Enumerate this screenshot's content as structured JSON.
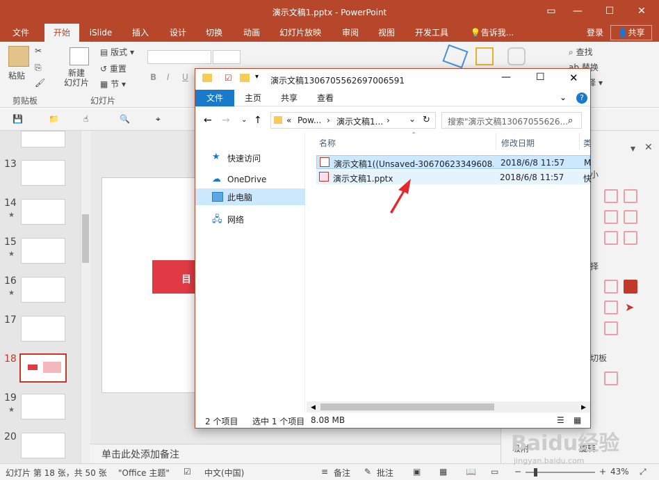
{
  "window": {
    "title": "演示文稿1.pptx - PowerPoint"
  },
  "ribbon_tabs": [
    "文件",
    "开始",
    "iSlide",
    "插入",
    "设计",
    "切换",
    "动画",
    "幻灯片放映",
    "审阅",
    "视图",
    "开发工具"
  ],
  "tell_me": "告诉我...",
  "login": "登录",
  "share": "共享",
  "ribbon": {
    "paste_label": "粘贴",
    "clipboard_label": "剪贴板",
    "new_slide_label": "新建\n幻灯片",
    "layout_label": "版式",
    "reset_label": "重置",
    "section_label": "节",
    "slides_group_label": "幻灯片",
    "find_label": "查找",
    "replace_label": "替换",
    "select_label": "选择"
  },
  "thumbnails": [
    {
      "num": "13",
      "star": ""
    },
    {
      "num": "14",
      "star": "★"
    },
    {
      "num": "15",
      "star": "★"
    },
    {
      "num": "16",
      "star": "★"
    },
    {
      "num": "17",
      "star": ""
    },
    {
      "num": "18",
      "star": ""
    },
    {
      "num": "19",
      "star": "★"
    },
    {
      "num": "20",
      "star": ""
    }
  ],
  "slide_text": "目",
  "notes_placeholder": "单击此处添加备注",
  "right_pane": {
    "frag1": "小",
    "frag2": "择",
    "frag3": "切板",
    "suck": "吸附",
    "rotate": "旋转"
  },
  "explorer": {
    "title": "演示文稿1306705562697006591",
    "tabs": [
      "文件",
      "主页",
      "共享",
      "查看"
    ],
    "address": [
      "«",
      "Pow...",
      "›",
      "演示文稿1...",
      "›"
    ],
    "search_placeholder": "搜索\"演示文稿13067055626...",
    "nav": [
      "快速访问",
      "OneDrive",
      "此电脑",
      "网络"
    ],
    "columns": {
      "name": "名称",
      "date": "修改日期",
      "type": "类"
    },
    "files": [
      {
        "name": "演示文稿1((Unsaved-30670623349608...",
        "date": "2018/6/8 11:57",
        "type": "M"
      },
      {
        "name": "演示文稿1.pptx",
        "date": "2018/6/8 11:57",
        "type": "快"
      }
    ],
    "status_count": "2 个项目",
    "status_selected": "选中 1 个项目",
    "status_size": "8.08 MB"
  },
  "status": {
    "slide_info": "幻灯片 第 18 张，共 50 张",
    "theme": "\"Office 主题\"",
    "language": "中文(中国)",
    "notes": "备注",
    "comments": "批注",
    "zoom": "43%"
  },
  "watermark": {
    "text": "Baidu经验",
    "sub": "jingyan.baidu.com"
  },
  "colors": {
    "accent": "#b7472a",
    "selected_thumb": "#c0392b",
    "explorer_blue": "#1979ca",
    "selected_row": "#cce8ff"
  }
}
